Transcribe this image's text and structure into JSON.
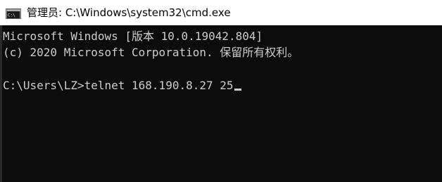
{
  "window": {
    "title": "管理员: C:\\Windows\\system32\\cmd.exe",
    "icon": "cmd-console-icon"
  },
  "console": {
    "lines": [
      "Microsoft Windows [版本 10.0.19042.804]",
      "(c) 2020 Microsoft Corporation. 保留所有权利。",
      "C:\\Users\\LZ>telnet 168.190.8.27 25"
    ]
  },
  "colors": {
    "console_background": "#0c0c0c",
    "console_text": "#cccccc",
    "titlebar_background": "#ffffff"
  }
}
